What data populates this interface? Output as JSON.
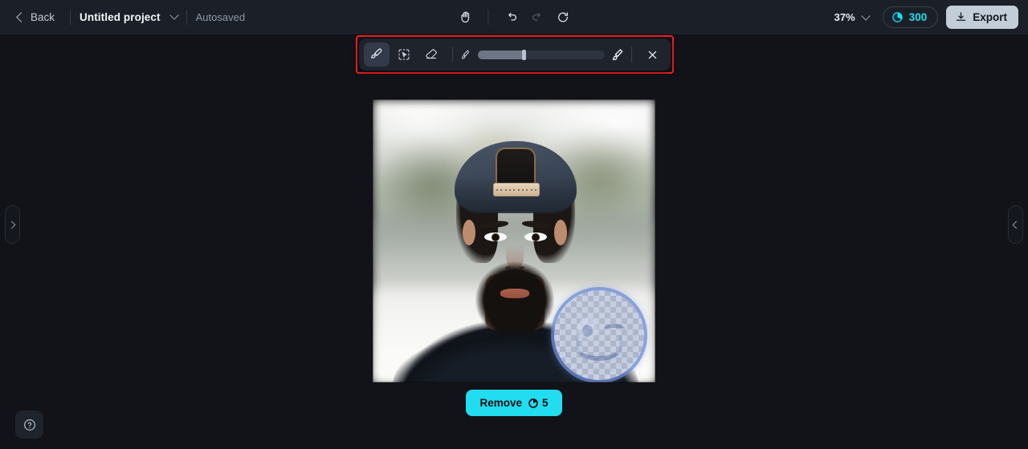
{
  "header": {
    "back_label": "Back",
    "project_name": "Untitled project",
    "autosaved_label": "Autosaved",
    "zoom_level": "37%",
    "credits_count": "300",
    "export_label": "Export",
    "tools": [
      {
        "name": "hand-tool",
        "title": "Hand"
      },
      {
        "name": "undo",
        "title": "Undo"
      },
      {
        "name": "redo",
        "title": "Redo"
      },
      {
        "name": "reset",
        "title": "Reset"
      }
    ]
  },
  "toolbar": {
    "brush_label": "Brush",
    "select_label": "Smart select",
    "eraser_label": "Eraser",
    "size_min_label": "Small brush",
    "size_max_label": "Large brush",
    "brush_size_percent": 36,
    "close_label": "Close",
    "highlight_color": "#fc1d21"
  },
  "canvas": {
    "left_panel_toggle": "Expand left panel",
    "right_panel_toggle": "Expand right panel",
    "help_label": "Help",
    "image_alt": "Portrait of a bearded man wearing a backwards cap outdoors",
    "selection_label": "Brush selection over emoji sticker"
  },
  "actions": {
    "remove_label": "Remove",
    "remove_cost": "5"
  },
  "colors": {
    "accent": "#22dcf0",
    "credits": "#28dcec",
    "export_bg": "#c3cdd8",
    "header_bg": "#1b2028",
    "canvas_bg": "#111318",
    "toolbar_bg": "#1e232c",
    "highlight": "#fc1d21"
  }
}
